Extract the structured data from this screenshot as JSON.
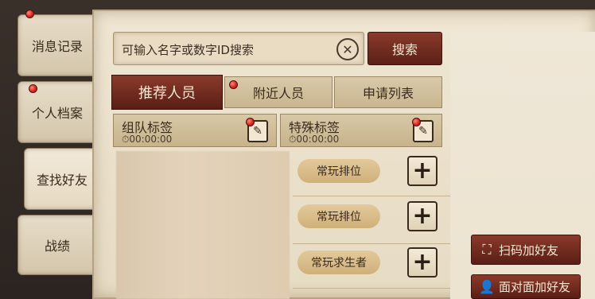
{
  "sidebar": {
    "items": [
      {
        "label": "消息记录"
      },
      {
        "label": "个人档案"
      },
      {
        "label": "查找好友"
      },
      {
        "label": "战绩"
      }
    ]
  },
  "search": {
    "placeholder": "可输入名字或数字ID搜索",
    "clear_icon": "✕",
    "button_label": "搜索"
  },
  "tabs": [
    {
      "label": "推荐人员"
    },
    {
      "label": "附近人员"
    },
    {
      "label": "申请列表"
    }
  ],
  "tags": {
    "team": {
      "title": "组队标签",
      "time": "00:00:00"
    },
    "special": {
      "title": "特殊标签",
      "time": "00:00:00"
    }
  },
  "list": {
    "rows": [
      {
        "tag": "常玩排位"
      },
      {
        "tag": "常玩排位"
      },
      {
        "tag": "常玩求生者"
      }
    ]
  },
  "actions": {
    "scan_label": "扫码加好友",
    "face_label": "面对面加好友"
  },
  "colors": {
    "accent": "#6e2a1e",
    "parchment": "#e9dfca",
    "notification": "#d8281e"
  }
}
